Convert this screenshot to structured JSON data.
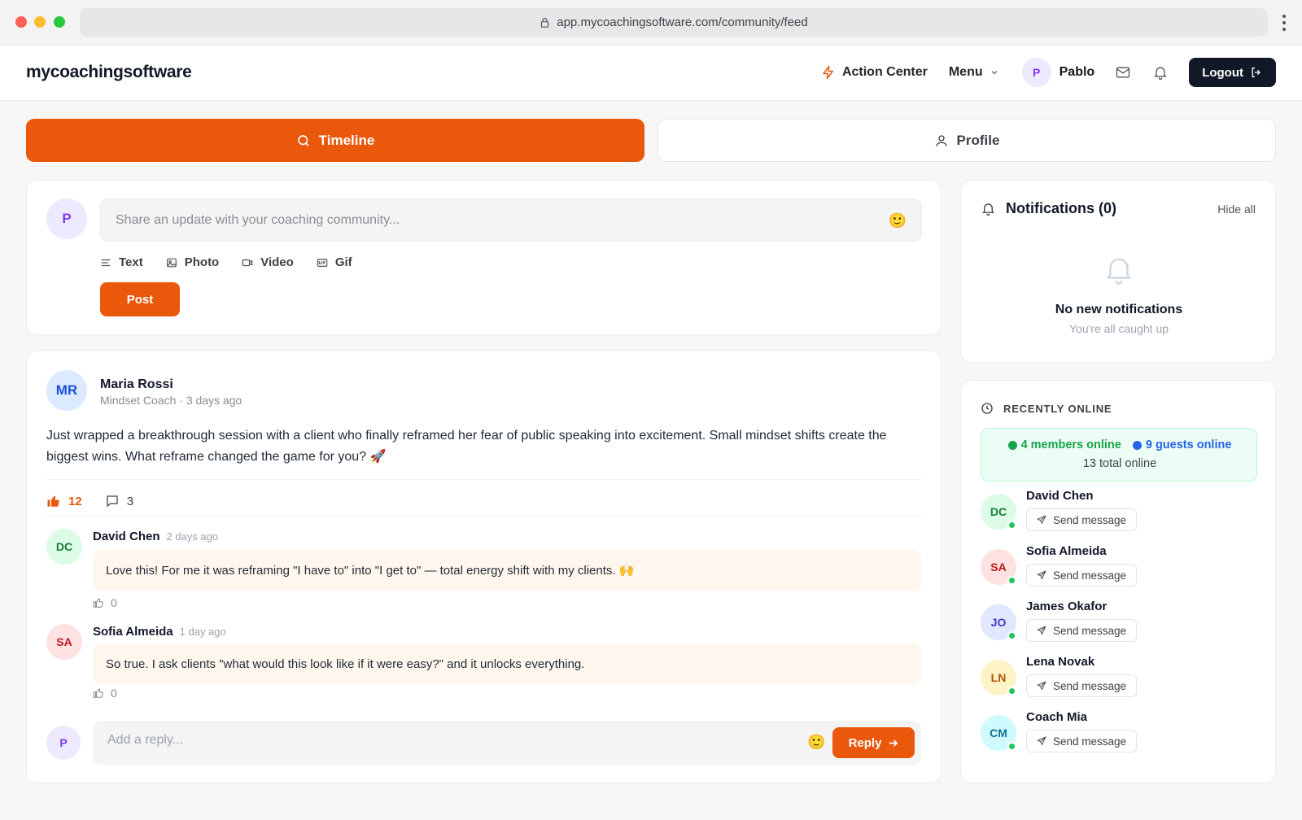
{
  "browser": {
    "url": "app.mycoachingsoftware.com/community/feed"
  },
  "header": {
    "logo": "mycoachingsoftware",
    "action_center": "Action Center",
    "menu": "Menu",
    "user_initial": "P",
    "user_name": "Pablo",
    "logout": "Logout"
  },
  "tabs": {
    "timeline": "Timeline",
    "profile": "Profile"
  },
  "composer": {
    "avatar": "P",
    "placeholder": "Share an update with your coaching community...",
    "emoji": "🙂",
    "types": {
      "text": "Text",
      "photo": "Photo",
      "video": "Video",
      "gif": "Gif"
    },
    "post_button": "Post"
  },
  "post": {
    "avatar": "MR",
    "author": "Maria Rossi",
    "meta": "Mindset Coach · 3 days ago",
    "body": "Just wrapped a breakthrough session with a client who finally reframed her fear of public speaking into excitement. Small mindset shifts create the biggest wins. What reframe changed the game for you? 🚀",
    "likes": "12",
    "comments_count": "3",
    "comments": [
      {
        "avatar": "DC",
        "name": "David Chen",
        "time": "2 days ago",
        "text": "Love this! For me it was reframing \"I have to\" into \"I get to\" — total energy shift with my clients. 🙌",
        "likes": "0"
      },
      {
        "avatar": "SA",
        "name": "Sofia Almeida",
        "time": "1 day ago",
        "text": "So true. I ask clients \"what would this look like if it were easy?\" and it unlocks everything.",
        "likes": "0"
      }
    ],
    "reply_avatar": "P",
    "reply_placeholder": "Add a reply...",
    "reply_emoji": "🙂",
    "reply_button": "Reply"
  },
  "notifications": {
    "title": "Notifications (0)",
    "hide_all": "Hide all",
    "empty_title": "No new notifications",
    "empty_sub": "You're all caught up"
  },
  "online": {
    "title": "RECENTLY ONLINE",
    "members": "4 members online",
    "guests": "9 guests online",
    "total": "13 total online",
    "send_label": "Send message",
    "people": [
      {
        "initials": "DC",
        "name": "David Chen"
      },
      {
        "initials": "SA",
        "name": "Sofia Almeida"
      },
      {
        "initials": "JO",
        "name": "James Okafor"
      },
      {
        "initials": "LN",
        "name": "Lena Novak"
      },
      {
        "initials": "CM",
        "name": "Coach Mia"
      }
    ]
  },
  "colors": {
    "accent": "#ea580c",
    "dark": "#111827",
    "online_green": "#22c55e",
    "guests_blue": "#2563eb"
  }
}
